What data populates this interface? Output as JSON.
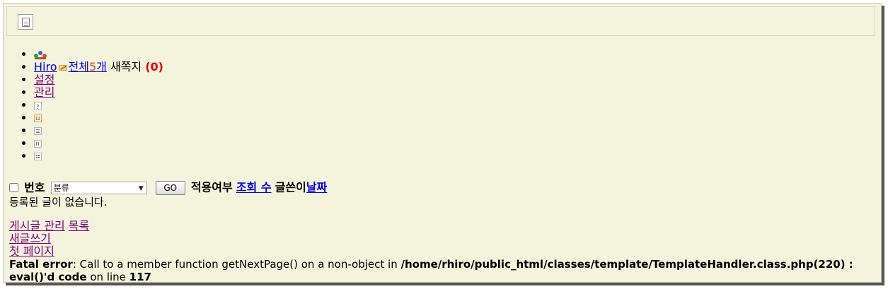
{
  "header": {
    "image_icon": "broken-image-icon"
  },
  "menu": {
    "icons": [
      "people-icon",
      "write-icon",
      "help-icon",
      "logout-icon",
      "list-view-icon",
      "detail-view-icon",
      "grid-view-icon"
    ],
    "user_name": "Hiro",
    "all_prefix": "전체",
    "all_count": "5",
    "all_suffix": "개",
    "memo_label": "새쪽지",
    "memo_count": "(0)",
    "settings_label": "설정",
    "admin_label": "관리"
  },
  "toolbar": {
    "number_label": "번호",
    "category_value": "분류",
    "go_label": "GO",
    "applied_label": "적용여부",
    "views_label": "조회 수",
    "writer_label": "글쓴이",
    "date_label": "날짜"
  },
  "messages": {
    "empty": "등록된 글이 없습니다."
  },
  "links": {
    "post_manage": "게시글 관리",
    "list": "목록",
    "new_post": "새글쓰기",
    "first_page": "첫 페이지"
  },
  "fatal": {
    "title": "Fatal error",
    "message": ": Call to a member function getNextPage() on a non-object in ",
    "path": "/home/rhiro/public_html/classes/template/TemplateHandler.class.php(220) : eval()'d code",
    "line_text": " on line ",
    "line_number": "117"
  },
  "colors": {
    "background": "#f4f3dc",
    "link": "#0000ee",
    "visited": "#800080",
    "count": "#e34b17",
    "memo": "#e00000"
  }
}
